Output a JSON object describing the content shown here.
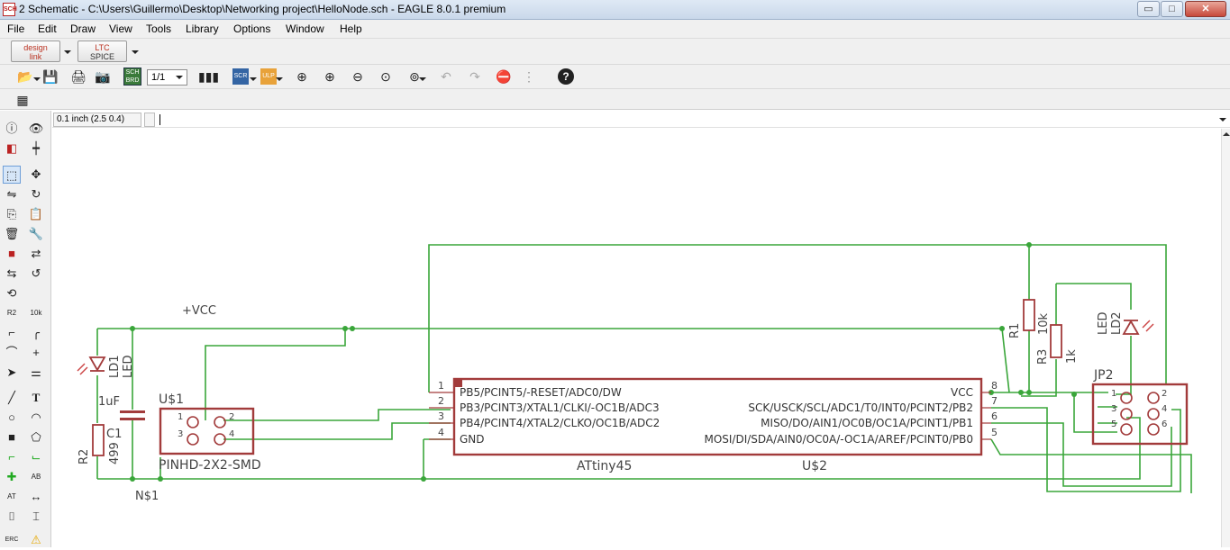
{
  "window": {
    "title": "2 Schematic - C:\\Users\\Guillermo\\Desktop\\Networking project\\HelloNode.sch - EAGLE 8.0.1 premium",
    "app_icon": "SCH",
    "min_label": "▭",
    "max_label": "□",
    "close_label": "✕"
  },
  "menu": [
    "File",
    "Edit",
    "Draw",
    "View",
    "Tools",
    "Library",
    "Options",
    "Window",
    "Help"
  ],
  "toolbar": {
    "designlink_line1": "design",
    "designlink_line2": "link",
    "ltspice_line1": "LTC",
    "ltspice_line2": "SPICE",
    "sheet_select": "1/1",
    "sch_brd_label": "SCH BRD",
    "scr_label": "SCR",
    "ulp_label": "ULP"
  },
  "icons": {
    "open": "📂",
    "save": "💾",
    "print": "🖨",
    "cam": "📷",
    "zoom_fit": "⊕",
    "zoom_in": "⊕",
    "zoom_out": "⊖",
    "zoom_select": "⊙",
    "zoom_prev": "⊚",
    "undo": "↶",
    "redo": "↷",
    "stop": "⛔",
    "go": "⋮",
    "help": "?",
    "grid": "▦"
  },
  "coordinates": "0.1 inch (2.5 0.4)",
  "command_value": "",
  "schematic": {
    "ic_name": "ATtiny45",
    "ic_ref": "U$2",
    "left_pins": [
      {
        "num": "1",
        "name": "PB5/PCINT5/-RESET/ADC0/DW"
      },
      {
        "num": "2",
        "name": "PB3/PCINT3/XTAL1/CLKI/-OC1B/ADC3"
      },
      {
        "num": "3",
        "name": "PB4/PCINT4/XTAL2/CLKO/OC1B/ADC2"
      },
      {
        "num": "4",
        "name": "GND"
      }
    ],
    "right_pins": [
      {
        "num": "8",
        "name": "VCC"
      },
      {
        "num": "7",
        "name": "SCK/USCK/SCL/ADC1/T0/INT0/PCINT2/PB2"
      },
      {
        "num": "6",
        "name": "MISO/DO/AIN1/OC0B/OC1A/PCINT1/PB1"
      },
      {
        "num": "5",
        "name": "MOSI/DI/SDA/AIN0/OC0A/-OC1A/AREF/PCINT0/PB0"
      }
    ],
    "header_ref": "U$1",
    "header_name": "PINHD-2X2-SMD",
    "header_pins": [
      "1",
      "2",
      "3",
      "4"
    ],
    "jp2_ref": "JP2",
    "jp2_pins": [
      "1",
      "2",
      "3",
      "4",
      "5",
      "6"
    ],
    "vcc_label": "+VCC",
    "gnd_label": "N$1",
    "c1_ref": "C1",
    "c1_value": "1uF",
    "r2_ref": "R2",
    "r2_value": "499",
    "ld1_ref": "LD1",
    "ld1_value": "LED",
    "r1_ref": "R1",
    "r1_value": "10k",
    "r3_ref": "R3",
    "r3_value": "1k",
    "ld2_ref": "LD2",
    "ld2_value": "LED"
  }
}
